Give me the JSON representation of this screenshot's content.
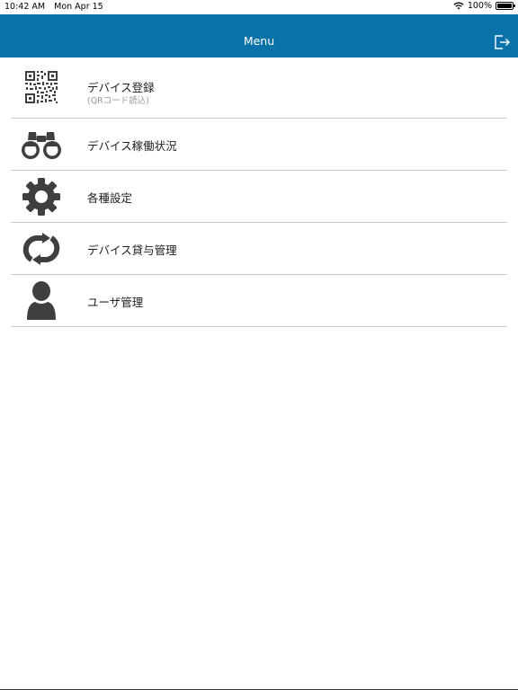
{
  "status": {
    "time": "10:42 AM",
    "date": "Mon Apr 15",
    "battery": "100%",
    "battery_level": 1.0
  },
  "header": {
    "title": "Menu"
  },
  "menu": {
    "items": [
      {
        "label": "デバイス登録",
        "sub": "(QRコード読込)",
        "icon": "qr-code-icon"
      },
      {
        "label": "デバイス稼働状況",
        "icon": "binoculars-icon"
      },
      {
        "label": "各種設定",
        "icon": "gear-icon"
      },
      {
        "label": "デバイス貸与管理",
        "icon": "refresh-arrows-icon"
      },
      {
        "label": "ユーザ管理",
        "icon": "user-icon"
      }
    ]
  },
  "colors": {
    "navbar": "#0a72a8",
    "icon": "#3f3f3f",
    "divider": "#c8c8c8"
  }
}
